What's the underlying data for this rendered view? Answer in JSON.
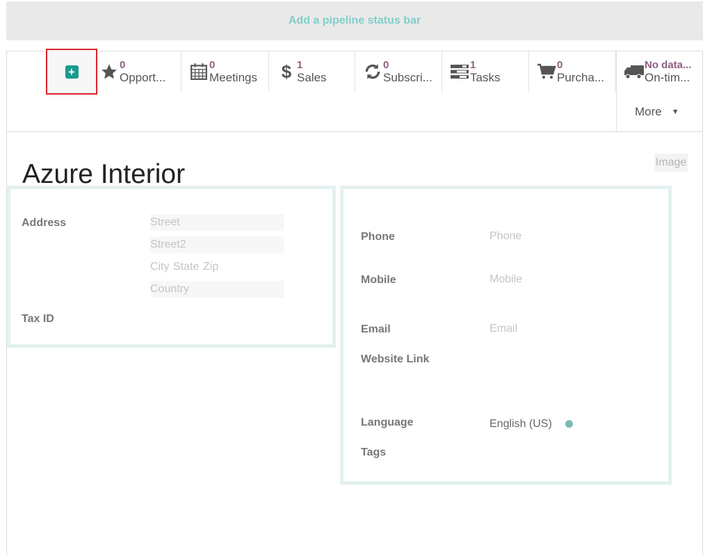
{
  "statusbar": {
    "label": "Add a pipeline status bar"
  },
  "buttonbox": {
    "buttons": [
      {
        "icon": "star-icon",
        "count": "0",
        "label": "Opport..."
      },
      {
        "icon": "calendar-icon",
        "count": "0",
        "label": "Meetings"
      },
      {
        "icon": "dollar-icon",
        "count": "1",
        "label": "Sales"
      },
      {
        "icon": "refresh-icon",
        "count": "0",
        "label": "Subscri..."
      },
      {
        "icon": "tasks-icon",
        "count": "1",
        "label": "Tasks"
      },
      {
        "icon": "cart-icon",
        "count": "0",
        "label": "Purcha..."
      },
      {
        "icon": "truck-icon",
        "count": "No data...",
        "label": "On-tim..."
      }
    ],
    "more_label": "More"
  },
  "record": {
    "name": "Azure Interior",
    "image_placeholder": "Image"
  },
  "address": {
    "label": "Address",
    "street_placeholder": "Street",
    "street2_placeholder": "Street2",
    "city_placeholder": "City",
    "state_placeholder": "State",
    "zip_placeholder": "Zip",
    "country_placeholder": "Country"
  },
  "tax": {
    "label": "Tax ID"
  },
  "contact": {
    "phone_label": "Phone",
    "phone_placeholder": "Phone",
    "mobile_label": "Mobile",
    "mobile_placeholder": "Mobile",
    "email_label": "Email",
    "email_placeholder": "Email",
    "website_label": "Website Link",
    "language_label": "Language",
    "language_value": "English (US)",
    "tags_label": "Tags"
  },
  "colors": {
    "accent": "#199a90",
    "highlight": "#d9262c",
    "count": "#8d5e84",
    "statusbar_text": "#7fcfcb"
  }
}
